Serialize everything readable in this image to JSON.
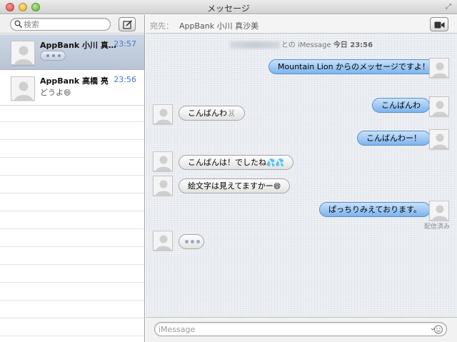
{
  "window": {
    "title": "メッセージ"
  },
  "search": {
    "placeholder": "検索"
  },
  "conversations": [
    {
      "name": "AppBank 小川 真…",
      "time": "23:57",
      "preview": "",
      "typing": true,
      "selected": true
    },
    {
      "name": "AppBank 高橋 亮",
      "time": "23:56",
      "preview": "どうよ",
      "typing": false,
      "selected": false
    }
  ],
  "header": {
    "to_label": "宛先：",
    "to_name": "AppBank 小川 真沙美"
  },
  "session": {
    "text": "との iMessage",
    "date": "今日 23:56"
  },
  "messages": [
    {
      "direction": "out",
      "text": "Mountain Lion からのメッセージですよ！"
    },
    {
      "direction": "out",
      "text": "こんばんわ"
    },
    {
      "direction": "in",
      "text": "こんばんわ",
      "emoji": "🐰"
    },
    {
      "direction": "out",
      "text": "こんばんわー！"
    },
    {
      "direction": "in",
      "text": "こんばんは！でしたね",
      "emoji": "💦💦"
    },
    {
      "direction": "in",
      "text": "絵文字は見えてますかー",
      "emoji": "😄"
    },
    {
      "direction": "out",
      "text": "ぱっちりみえております。"
    },
    {
      "direction": "in",
      "text": "",
      "typing": true
    }
  ],
  "status": {
    "delivered": "配信済み"
  },
  "composer": {
    "placeholder": "iMessage"
  },
  "colors": {
    "outgoing_bubble": "#8fc0f2",
    "incoming_bubble": "#f0f0f0",
    "time_text": "#3a7bd5"
  }
}
